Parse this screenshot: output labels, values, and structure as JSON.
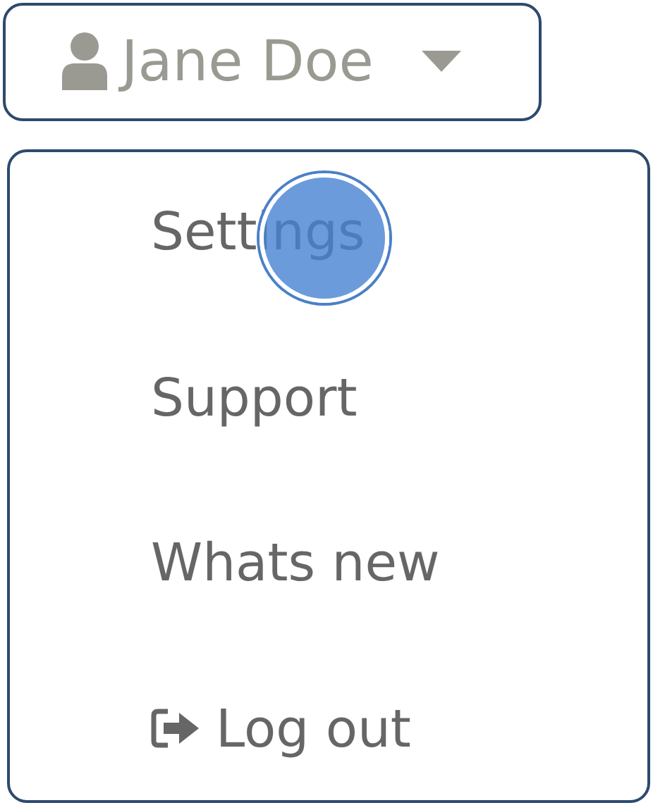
{
  "user_button": {
    "label": "Jane Doe"
  },
  "menu": {
    "items": [
      {
        "label": "Settings",
        "kind": "text",
        "touched": true
      },
      {
        "label": "Support",
        "kind": "text",
        "touched": false
      },
      {
        "label": "Whats new",
        "kind": "text",
        "touched": false
      },
      {
        "label": "Log out",
        "kind": "logout",
        "touched": false
      }
    ]
  }
}
